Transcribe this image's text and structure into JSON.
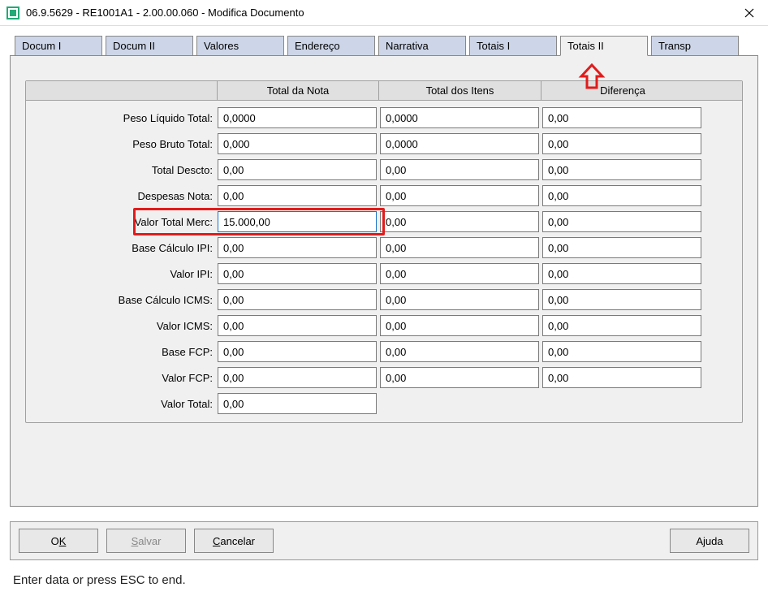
{
  "window": {
    "title": "06.9.5629 - RE1001A1 - 2.00.00.060 - Modifica Documento"
  },
  "tabs": [
    {
      "label": "Docum I"
    },
    {
      "label": "Docum II"
    },
    {
      "label": "Valores"
    },
    {
      "label": "Endereço"
    },
    {
      "label": "Narrativa"
    },
    {
      "label": "Totais I"
    },
    {
      "label": "Totais II"
    },
    {
      "label": "Transp"
    }
  ],
  "active_tab_index": 6,
  "columns": {
    "nota": "Total da Nota",
    "itens": "Total dos Itens",
    "dif": "Diferença"
  },
  "rows": [
    {
      "label": "Peso Líquido Total:",
      "nota": "0,0000",
      "itens": "0,0000",
      "dif": "0,00"
    },
    {
      "label": "Peso Bruto Total:",
      "nota": "0,000",
      "itens": "0,0000",
      "dif": "0,00"
    },
    {
      "label": "Total Descto:",
      "nota": "0,00",
      "itens": "0,00",
      "dif": "0,00"
    },
    {
      "label": "Despesas Nota:",
      "nota": "0,00",
      "itens": "0,00",
      "dif": "0,00"
    },
    {
      "label": "Valor Total Merc:",
      "nota": "15.000,00",
      "itens": "0,00",
      "dif": "0,00",
      "highlight": true
    },
    {
      "label": "Base Cálculo IPI:",
      "nota": "0,00",
      "itens": "0,00",
      "dif": "0,00"
    },
    {
      "label": "Valor IPI:",
      "nota": "0,00",
      "itens": "0,00",
      "dif": "0,00"
    },
    {
      "label": "Base Cálculo ICMS:",
      "nota": "0,00",
      "itens": "0,00",
      "dif": "0,00"
    },
    {
      "label": "Valor ICMS:",
      "nota": "0,00",
      "itens": "0,00",
      "dif": "0,00"
    },
    {
      "label": "Base FCP:",
      "nota": "0,00",
      "itens": "0,00",
      "dif": "0,00"
    },
    {
      "label": "Valor FCP:",
      "nota": "0,00",
      "itens": "0,00",
      "dif": "0,00"
    },
    {
      "label": "Valor Total:",
      "nota": "0,00"
    }
  ],
  "buttons": {
    "ok_pre": "O",
    "ok_ul": "K",
    "salvar_ul": "S",
    "salvar_post": "alvar",
    "cancelar_ul": "C",
    "cancelar_post": "ancelar",
    "ajuda_pre": "A",
    "ajuda_ul": "j",
    "ajuda_post": "uda"
  },
  "status": "Enter data or press ESC to end."
}
